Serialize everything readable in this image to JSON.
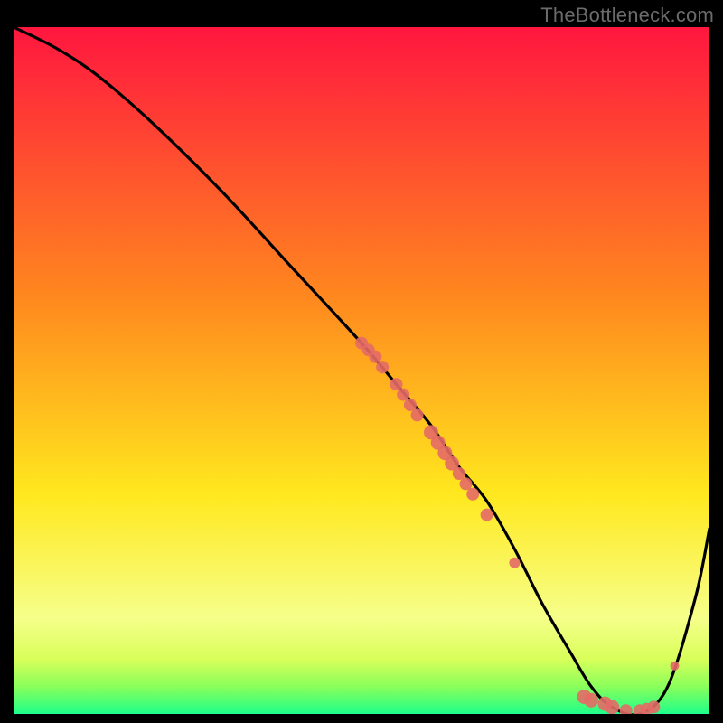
{
  "watermark": "TheBottleneck.com",
  "colors": {
    "top": "#ff163f",
    "mid1": "#ff8a1e",
    "mid2": "#ffe81e",
    "mid3": "#f6ff8a",
    "band1": "#d9ff5a",
    "band2": "#8aff5a",
    "band3": "#1eff8a",
    "line": "#000000",
    "marker": "#e46a66",
    "frame": "#000000"
  },
  "chart_data": {
    "type": "line",
    "title": "",
    "xlabel": "",
    "ylabel": "",
    "xlim": [
      0,
      100
    ],
    "ylim": [
      0,
      100
    ],
    "series": [
      {
        "name": "curve",
        "x": [
          0,
          6,
          12,
          20,
          30,
          40,
          50,
          55,
          60,
          64,
          68,
          72,
          76,
          80,
          83,
          86,
          90,
          94,
          98,
          100
        ],
        "y": [
          100,
          97,
          93,
          86,
          76,
          65,
          54,
          48,
          42,
          36,
          31,
          24,
          16,
          9,
          4,
          1,
          0,
          4,
          17,
          27
        ]
      }
    ],
    "markers": [
      {
        "x": 50,
        "y": 54,
        "r": 7
      },
      {
        "x": 51,
        "y": 53,
        "r": 7
      },
      {
        "x": 52,
        "y": 52,
        "r": 7
      },
      {
        "x": 53,
        "y": 50.5,
        "r": 7
      },
      {
        "x": 55,
        "y": 48,
        "r": 7
      },
      {
        "x": 56,
        "y": 46.5,
        "r": 7
      },
      {
        "x": 57,
        "y": 45,
        "r": 7
      },
      {
        "x": 58,
        "y": 43.5,
        "r": 7
      },
      {
        "x": 60,
        "y": 41,
        "r": 8
      },
      {
        "x": 61,
        "y": 39.5,
        "r": 8
      },
      {
        "x": 62,
        "y": 38,
        "r": 8
      },
      {
        "x": 63,
        "y": 36.5,
        "r": 8
      },
      {
        "x": 64,
        "y": 35,
        "r": 7
      },
      {
        "x": 65,
        "y": 33.5,
        "r": 7
      },
      {
        "x": 66,
        "y": 32,
        "r": 7
      },
      {
        "x": 68,
        "y": 29,
        "r": 7
      },
      {
        "x": 72,
        "y": 22,
        "r": 6
      },
      {
        "x": 82,
        "y": 2.5,
        "r": 8
      },
      {
        "x": 83,
        "y": 2,
        "r": 8
      },
      {
        "x": 85,
        "y": 1.5,
        "r": 8
      },
      {
        "x": 86,
        "y": 1,
        "r": 8
      },
      {
        "x": 88,
        "y": 0.5,
        "r": 7
      },
      {
        "x": 90,
        "y": 0.5,
        "r": 7
      },
      {
        "x": 91,
        "y": 0.7,
        "r": 7
      },
      {
        "x": 92,
        "y": 1,
        "r": 7
      },
      {
        "x": 95,
        "y": 7,
        "r": 5
      }
    ]
  }
}
